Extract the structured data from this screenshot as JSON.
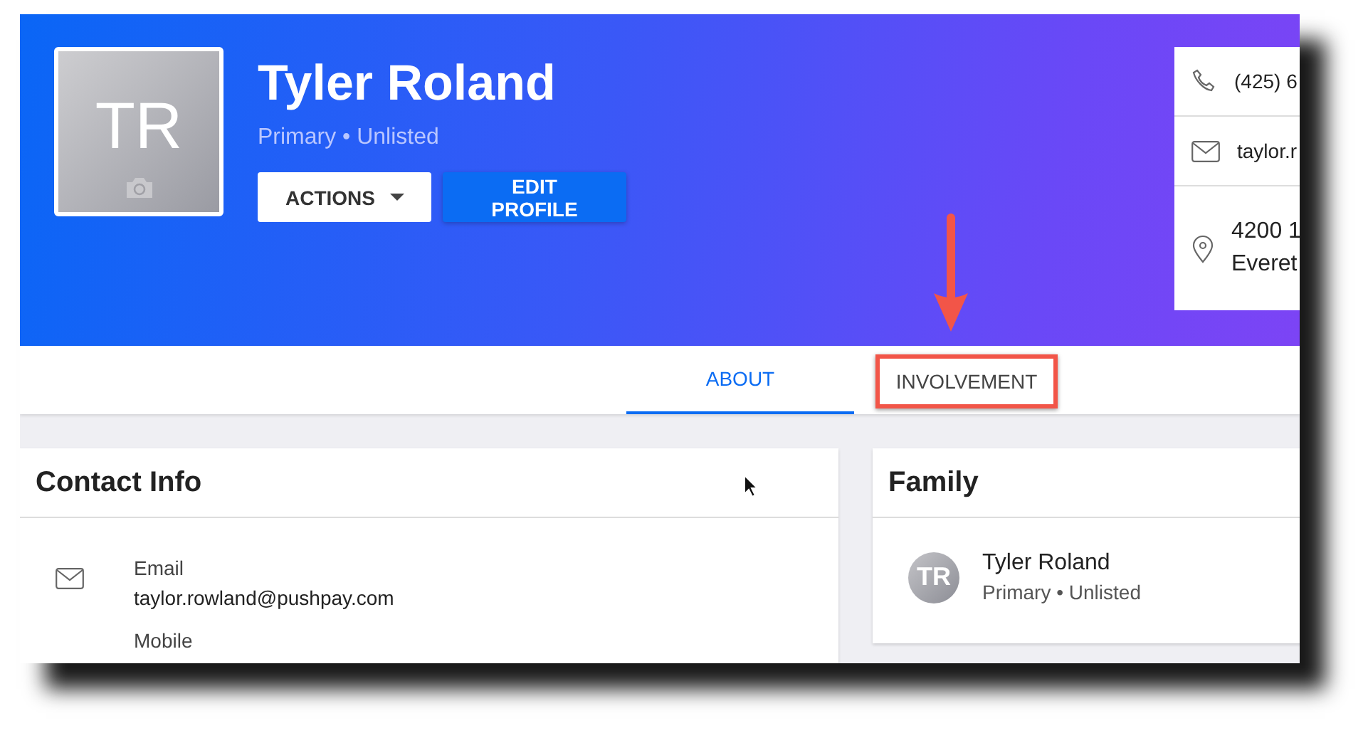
{
  "profile": {
    "initials": "TR",
    "name": "Tyler Roland",
    "subtitle": "Primary • Unlisted",
    "buttons": [
      {
        "label": "ACTIONS",
        "kind": "dropdown"
      },
      {
        "label": "EDIT PROFILE",
        "kind": "primary"
      }
    ]
  },
  "quick_contact": [
    {
      "kind": "phone",
      "lines": [
        "(425) 6"
      ]
    },
    {
      "kind": "email",
      "lines": [
        "taylor.r"
      ]
    },
    {
      "kind": "address",
      "lines": [
        "4200 1",
        "Everet"
      ]
    }
  ],
  "tabs": [
    {
      "label": "ABOUT",
      "selected": true,
      "highlighted": false
    },
    {
      "label": "INVOLVEMENT",
      "selected": false,
      "highlighted": true
    }
  ],
  "contact_info": {
    "title": "Contact Info",
    "items": [
      {
        "kind": "email",
        "label": "Email",
        "value": "taylor.rowland@pushpay.com"
      },
      {
        "kind": "mobile",
        "label": "Mobile"
      }
    ]
  },
  "family": {
    "title": "Family",
    "members": [
      {
        "initials": "TR",
        "name": "Tyler Roland",
        "subtitle": "Primary • Unlisted"
      }
    ]
  }
}
